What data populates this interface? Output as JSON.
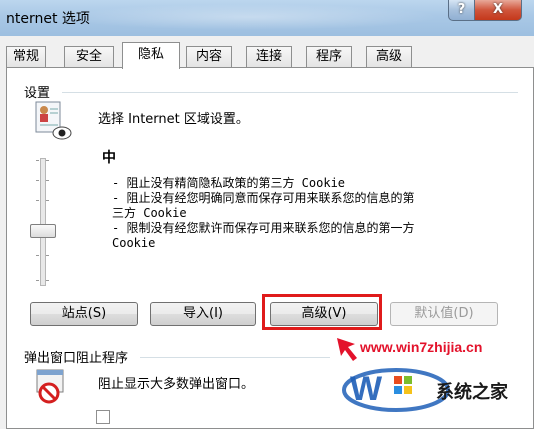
{
  "window": {
    "title": "nternet 选项",
    "help_label": "?",
    "close_label": "X"
  },
  "tabs": [
    {
      "label": "常规"
    },
    {
      "label": "安全"
    },
    {
      "label": "隐私",
      "active": true
    },
    {
      "label": "内容"
    },
    {
      "label": "连接"
    },
    {
      "label": "程序"
    },
    {
      "label": "高级"
    }
  ],
  "settings": {
    "group_label": "设置",
    "zone_text": "选择 Internet 区域设置。",
    "level_label": "中",
    "description_lines": [
      "- 阻止没有精简隐私政策的第三方 Cookie",
      "- 阻止没有经您明确同意而保存可用来联系您的信息的第",
      "三方 Cookie",
      "- 限制没有经您默许而保存可用来联系您的信息的第一方",
      "Cookie"
    ]
  },
  "buttons": {
    "sites": "站点(S)",
    "import": "导入(I)",
    "advanced": "高级(V)",
    "default": "默认值(D)"
  },
  "popup_blocker": {
    "group_label": "弹出窗口阻止程序",
    "text": "阻止显示大多数弹出窗口。"
  },
  "watermark": {
    "url": "www.win7zhijia.cn",
    "name": "系统之家"
  },
  "colors": {
    "highlight": "#e01b1b",
    "watermark_red": "#e3122b",
    "watermark_blue": "#1f5fb7"
  }
}
